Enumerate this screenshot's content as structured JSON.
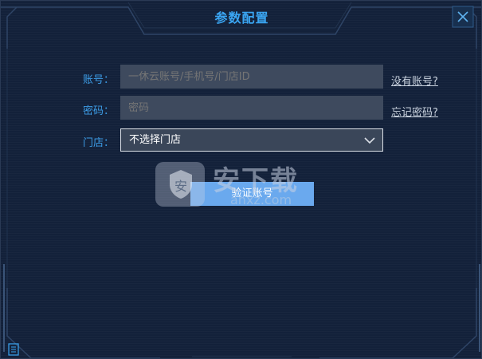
{
  "window": {
    "title": "参数配置",
    "close_icon": "close-x-icon"
  },
  "form": {
    "account_label": "账号：",
    "account_placeholder": "一休云账号/手机号/门店ID",
    "account_value": "",
    "password_label": "密码：",
    "password_placeholder": "密码",
    "password_value": "",
    "store_label": "门店：",
    "store_selected": "不选择门店",
    "store_arrow_icon": "chevron-down-icon"
  },
  "links": {
    "no_account": "没有账号?",
    "forgot_password": "忘记密码?"
  },
  "actions": {
    "verify_account": "验证账号"
  },
  "watermark": {
    "text": "安下载",
    "sub": "anxz.com"
  },
  "colors": {
    "background": "#13213a",
    "accent": "#3aa5f2",
    "input_bg": "#3e4a5e",
    "button_bg": "#6aa9ee"
  }
}
